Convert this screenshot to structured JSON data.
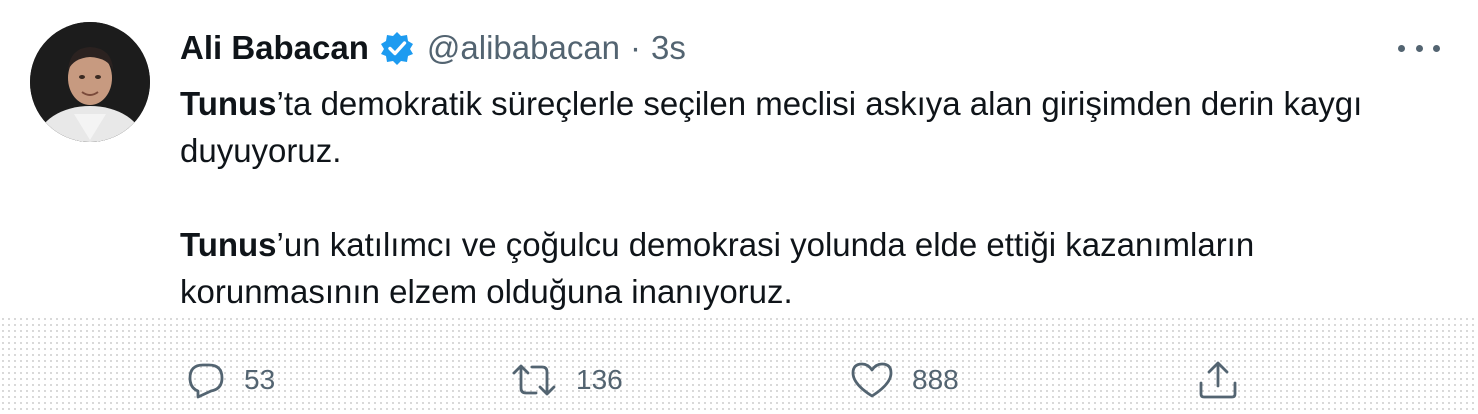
{
  "author": {
    "name": "Ali Babacan",
    "handle": "@alibabacan",
    "separator": "·",
    "time": "3s",
    "verified": true,
    "verified_color": "#1d9bf0"
  },
  "tweet": {
    "paragraphs": [
      {
        "bold": "Tunus",
        "rest": "’ta demokratik süreçlerle seçilen meclisi askıya alan girişimden derin kaygı duyuyoruz."
      },
      {
        "bold": "Tunus",
        "rest": "’un katılımcı ve çoğulcu demokrasi yolunda elde ettiği kazanımların korunmasının elzem olduğuna inanıyoruz."
      }
    ]
  },
  "actions": {
    "reply": {
      "icon": "reply-icon",
      "count": "53"
    },
    "retweet": {
      "icon": "retweet-icon",
      "count": "136"
    },
    "like": {
      "icon": "heart-icon",
      "count": "888"
    },
    "share": {
      "icon": "share-icon"
    }
  },
  "more_menu": {
    "icon": "more-options-icon"
  }
}
